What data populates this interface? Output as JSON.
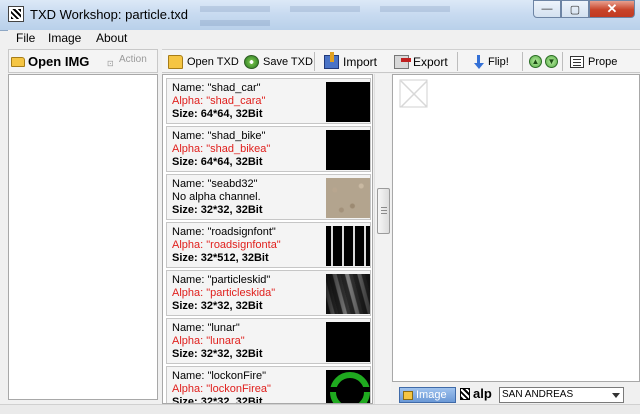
{
  "window": {
    "title": "TXD Workshop: particle.txd",
    "min_label": "—",
    "max_label": "▢",
    "close_label": "✕"
  },
  "menu": [
    "File",
    "Image",
    "About"
  ],
  "left_toolbar": {
    "open_label": "Open IMG",
    "action_label": "Action"
  },
  "toolbar": {
    "open_txd": "Open TXD",
    "save_txd": "Save TXD",
    "import": "Import",
    "export": "Export",
    "flip": "Flip!",
    "up": "▲",
    "down": "▼",
    "properties": "Prope"
  },
  "textures": [
    {
      "name": "Name: \"shad_car\"",
      "alpha": "Alpha: \"shad_cara\"",
      "has_alpha": true,
      "size": "Size: 64*64, 32Bit",
      "thumb": "black"
    },
    {
      "name": "Name: \"shad_bike\"",
      "alpha": "Alpha: \"shad_bikea\"",
      "has_alpha": true,
      "size": "Size: 64*64, 32Bit",
      "thumb": "black"
    },
    {
      "name": "Name: \"seabd32\"",
      "alpha": "No alpha channel.",
      "has_alpha": false,
      "size": "Size: 32*32, 32Bit",
      "thumb": "sand"
    },
    {
      "name": "Name: \"roadsignfont\"",
      "alpha": "Alpha: \"roadsignfonta\"",
      "has_alpha": true,
      "size": "Size: 32*512, 32Bit",
      "thumb": "font"
    },
    {
      "name": "Name: \"particleskid\"",
      "alpha": "Alpha: \"particleskida\"",
      "has_alpha": true,
      "size": "Size: 32*32, 32Bit",
      "thumb": "skid"
    },
    {
      "name": "Name: \"lunar\"",
      "alpha": "Alpha: \"lunara\"",
      "has_alpha": true,
      "size": "Size: 32*32, 32Bit",
      "thumb": "black"
    },
    {
      "name": "Name: \"lockonFire\"",
      "alpha": "Alpha: \"lockonFirea\"",
      "has_alpha": true,
      "size": "Size: 32*32, 32Bit",
      "thumb": "ring"
    }
  ],
  "bottom": {
    "image_tab": "Image",
    "alpha_tab": "alp",
    "game_select": "SAN ANDREAS"
  },
  "colors": {
    "alpha_text": "#e0201d",
    "titlebar": "#c7daf0",
    "close_button": "#c8442a"
  }
}
